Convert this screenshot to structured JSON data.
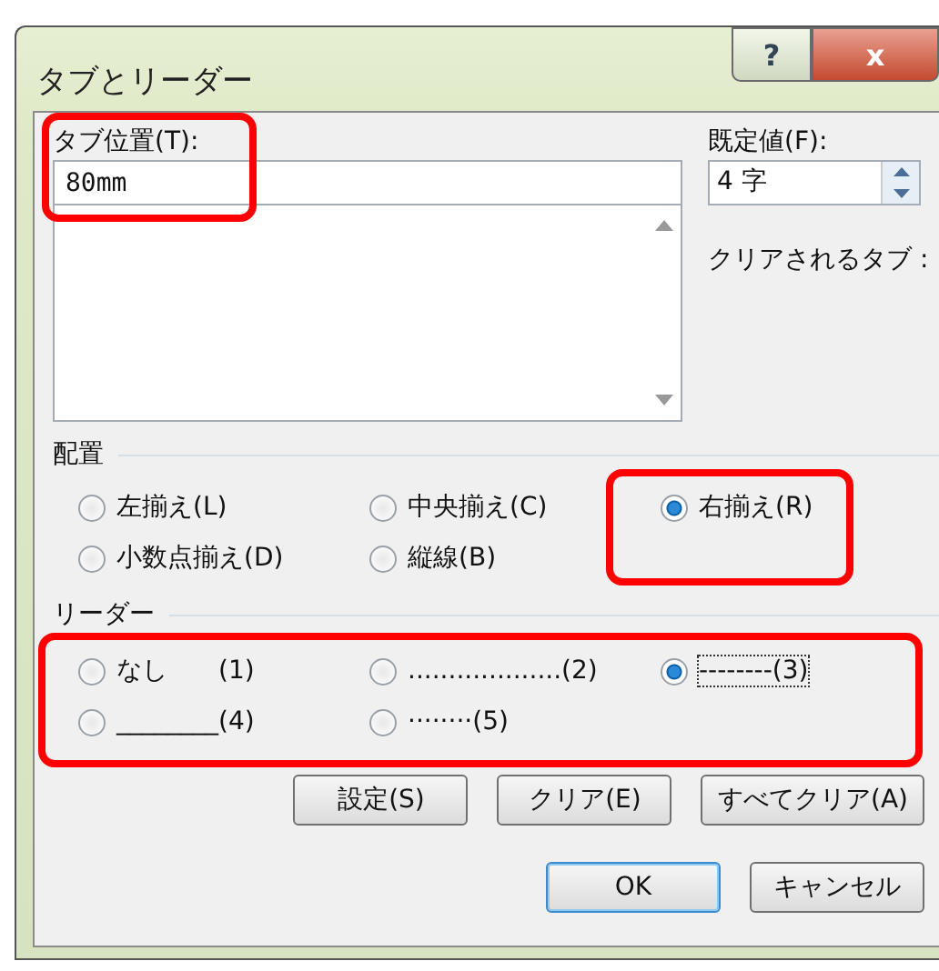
{
  "window": {
    "title": "タブとリーダー",
    "buttons": [
      "?",
      "x"
    ]
  },
  "tab_position": {
    "label": "タブ位置(T):",
    "value": "80mm",
    "highlighted": true
  },
  "default_tabs": {
    "label": "既定値(F):",
    "value": "4 字"
  },
  "tabs_to_clear": {
    "label": "クリアされるタブ :"
  },
  "alignment": {
    "title": "配置",
    "options": [
      {
        "label": "左揃え(L)",
        "selected": false,
        "highlighted": false
      },
      {
        "label": "中央揃え(C)",
        "selected": false,
        "highlighted": false
      },
      {
        "label": "右揃え(R)",
        "selected": true,
        "highlighted": true
      },
      {
        "label": "小数点揃え(D)",
        "selected": false,
        "highlighted": false
      },
      {
        "label": "縦線(B)",
        "selected": false,
        "highlighted": false
      }
    ]
  },
  "leader": {
    "title": "リーダー",
    "highlighted": true,
    "options": [
      {
        "label": "なし　　(1)",
        "selected": false
      },
      {
        "label": "...................(2)",
        "selected": false
      },
      {
        "label": "--------(3)",
        "selected": true
      },
      {
        "label": "________(4)",
        "selected": false
      },
      {
        "label": "········(5)",
        "selected": false
      }
    ]
  },
  "action_buttons": [
    "設定(S)",
    "クリア(E)",
    "すべてクリア(A)"
  ],
  "dialog_buttons": [
    {
      "label": "OK",
      "default": true
    },
    {
      "label": "キャンセル",
      "default": false
    }
  ]
}
